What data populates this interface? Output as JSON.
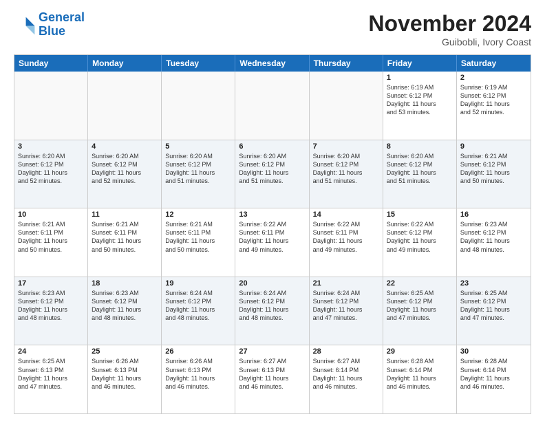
{
  "logo": {
    "line1": "General",
    "line2": "Blue"
  },
  "title": "November 2024",
  "subtitle": "Guibobli, Ivory Coast",
  "header_days": [
    "Sunday",
    "Monday",
    "Tuesday",
    "Wednesday",
    "Thursday",
    "Friday",
    "Saturday"
  ],
  "rows": [
    [
      {
        "day": "",
        "info": "",
        "empty": true
      },
      {
        "day": "",
        "info": "",
        "empty": true
      },
      {
        "day": "",
        "info": "",
        "empty": true
      },
      {
        "day": "",
        "info": "",
        "empty": true
      },
      {
        "day": "",
        "info": "",
        "empty": true
      },
      {
        "day": "1",
        "info": "Sunrise: 6:19 AM\nSunset: 6:12 PM\nDaylight: 11 hours\nand 53 minutes.",
        "empty": false
      },
      {
        "day": "2",
        "info": "Sunrise: 6:19 AM\nSunset: 6:12 PM\nDaylight: 11 hours\nand 52 minutes.",
        "empty": false
      }
    ],
    [
      {
        "day": "3",
        "info": "Sunrise: 6:20 AM\nSunset: 6:12 PM\nDaylight: 11 hours\nand 52 minutes.",
        "empty": false
      },
      {
        "day": "4",
        "info": "Sunrise: 6:20 AM\nSunset: 6:12 PM\nDaylight: 11 hours\nand 52 minutes.",
        "empty": false
      },
      {
        "day": "5",
        "info": "Sunrise: 6:20 AM\nSunset: 6:12 PM\nDaylight: 11 hours\nand 51 minutes.",
        "empty": false
      },
      {
        "day": "6",
        "info": "Sunrise: 6:20 AM\nSunset: 6:12 PM\nDaylight: 11 hours\nand 51 minutes.",
        "empty": false
      },
      {
        "day": "7",
        "info": "Sunrise: 6:20 AM\nSunset: 6:12 PM\nDaylight: 11 hours\nand 51 minutes.",
        "empty": false
      },
      {
        "day": "8",
        "info": "Sunrise: 6:20 AM\nSunset: 6:12 PM\nDaylight: 11 hours\nand 51 minutes.",
        "empty": false
      },
      {
        "day": "9",
        "info": "Sunrise: 6:21 AM\nSunset: 6:12 PM\nDaylight: 11 hours\nand 50 minutes.",
        "empty": false
      }
    ],
    [
      {
        "day": "10",
        "info": "Sunrise: 6:21 AM\nSunset: 6:11 PM\nDaylight: 11 hours\nand 50 minutes.",
        "empty": false
      },
      {
        "day": "11",
        "info": "Sunrise: 6:21 AM\nSunset: 6:11 PM\nDaylight: 11 hours\nand 50 minutes.",
        "empty": false
      },
      {
        "day": "12",
        "info": "Sunrise: 6:21 AM\nSunset: 6:11 PM\nDaylight: 11 hours\nand 50 minutes.",
        "empty": false
      },
      {
        "day": "13",
        "info": "Sunrise: 6:22 AM\nSunset: 6:11 PM\nDaylight: 11 hours\nand 49 minutes.",
        "empty": false
      },
      {
        "day": "14",
        "info": "Sunrise: 6:22 AM\nSunset: 6:11 PM\nDaylight: 11 hours\nand 49 minutes.",
        "empty": false
      },
      {
        "day": "15",
        "info": "Sunrise: 6:22 AM\nSunset: 6:12 PM\nDaylight: 11 hours\nand 49 minutes.",
        "empty": false
      },
      {
        "day": "16",
        "info": "Sunrise: 6:23 AM\nSunset: 6:12 PM\nDaylight: 11 hours\nand 48 minutes.",
        "empty": false
      }
    ],
    [
      {
        "day": "17",
        "info": "Sunrise: 6:23 AM\nSunset: 6:12 PM\nDaylight: 11 hours\nand 48 minutes.",
        "empty": false
      },
      {
        "day": "18",
        "info": "Sunrise: 6:23 AM\nSunset: 6:12 PM\nDaylight: 11 hours\nand 48 minutes.",
        "empty": false
      },
      {
        "day": "19",
        "info": "Sunrise: 6:24 AM\nSunset: 6:12 PM\nDaylight: 11 hours\nand 48 minutes.",
        "empty": false
      },
      {
        "day": "20",
        "info": "Sunrise: 6:24 AM\nSunset: 6:12 PM\nDaylight: 11 hours\nand 48 minutes.",
        "empty": false
      },
      {
        "day": "21",
        "info": "Sunrise: 6:24 AM\nSunset: 6:12 PM\nDaylight: 11 hours\nand 47 minutes.",
        "empty": false
      },
      {
        "day": "22",
        "info": "Sunrise: 6:25 AM\nSunset: 6:12 PM\nDaylight: 11 hours\nand 47 minutes.",
        "empty": false
      },
      {
        "day": "23",
        "info": "Sunrise: 6:25 AM\nSunset: 6:12 PM\nDaylight: 11 hours\nand 47 minutes.",
        "empty": false
      }
    ],
    [
      {
        "day": "24",
        "info": "Sunrise: 6:25 AM\nSunset: 6:13 PM\nDaylight: 11 hours\nand 47 minutes.",
        "empty": false
      },
      {
        "day": "25",
        "info": "Sunrise: 6:26 AM\nSunset: 6:13 PM\nDaylight: 11 hours\nand 46 minutes.",
        "empty": false
      },
      {
        "day": "26",
        "info": "Sunrise: 6:26 AM\nSunset: 6:13 PM\nDaylight: 11 hours\nand 46 minutes.",
        "empty": false
      },
      {
        "day": "27",
        "info": "Sunrise: 6:27 AM\nSunset: 6:13 PM\nDaylight: 11 hours\nand 46 minutes.",
        "empty": false
      },
      {
        "day": "28",
        "info": "Sunrise: 6:27 AM\nSunset: 6:14 PM\nDaylight: 11 hours\nand 46 minutes.",
        "empty": false
      },
      {
        "day": "29",
        "info": "Sunrise: 6:28 AM\nSunset: 6:14 PM\nDaylight: 11 hours\nand 46 minutes.",
        "empty": false
      },
      {
        "day": "30",
        "info": "Sunrise: 6:28 AM\nSunset: 6:14 PM\nDaylight: 11 hours\nand 46 minutes.",
        "empty": false
      }
    ]
  ]
}
